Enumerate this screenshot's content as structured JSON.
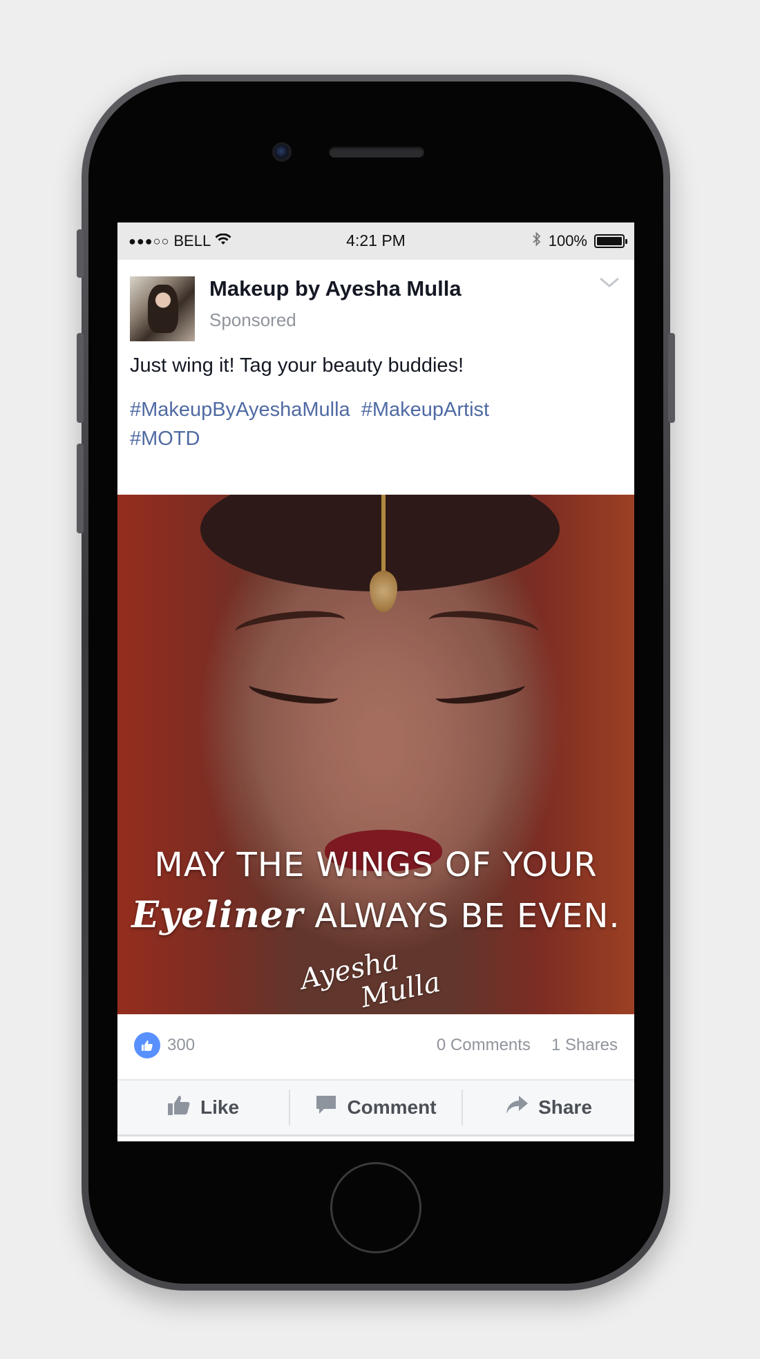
{
  "status_bar": {
    "signal": "●●●○○",
    "carrier": "BELL",
    "time": "4:21 PM",
    "battery_percent": "100%",
    "battery_level": 1.0
  },
  "post": {
    "page_name": "Makeup by Ayesha Mulla",
    "sponsored_label": "Sponsored",
    "text": "Just wing it! Tag your beauty buddies!",
    "hashtags": [
      "#MakeupByAyeshaMulla",
      "#MakeupArtist",
      "#MOTD"
    ],
    "image": {
      "quote_line1": "MAY THE WINGS OF YOUR",
      "quote_script_word": "Eyeliner",
      "quote_line2_rest": "ALWAYS BE EVEN.",
      "signature_line1": "Ayesha",
      "signature_line2": "Mulla"
    }
  },
  "stats": {
    "like_count": "300",
    "comments": "0 Comments",
    "shares": "1 Shares"
  },
  "actions": {
    "like": "Like",
    "comment": "Comment",
    "share": "Share"
  },
  "colors": {
    "link": "#4f6aa3",
    "like_blue": "#5890ff",
    "meta_gray": "#90949c"
  }
}
